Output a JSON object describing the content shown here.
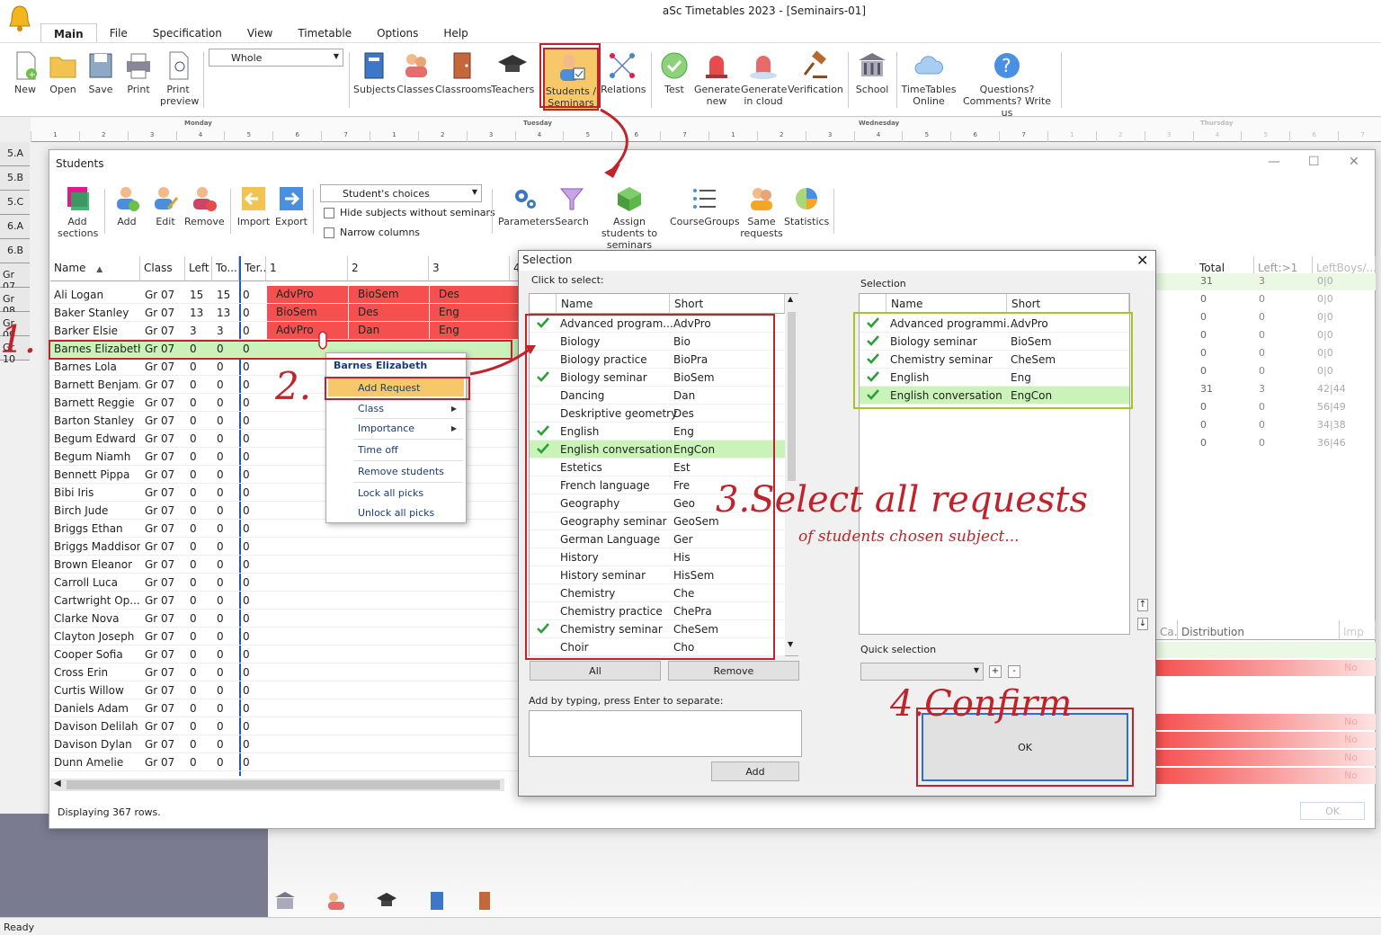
{
  "app": {
    "title": "aSc Timetables 2023  - [Seminairs-01]",
    "status": "Ready"
  },
  "ribbon": {
    "tabs": [
      "Main",
      "File",
      "Specification",
      "View",
      "Timetable",
      "Options",
      "Help"
    ],
    "view_select": "Whole",
    "buttons": {
      "new": "New",
      "open": "Open",
      "save": "Save",
      "print": "Print",
      "print_preview": "Print preview",
      "subjects": "Subjects",
      "classes": "Classes",
      "classrooms": "Classrooms",
      "teachers": "Teachers",
      "students_seminars": "Students / Seminars",
      "relations": "Relations",
      "test": "Test",
      "generate_new": "Generate new",
      "generate_cloud": "Generate in cloud",
      "verification": "Verification",
      "school": "School",
      "timetables_online": "TimeTables Online",
      "questions": "Questions? Comments? Write us"
    }
  },
  "timetable": {
    "days": [
      "Monday",
      "Tuesday",
      "Wednesday",
      "Thursday"
    ],
    "periods": [
      "1",
      "2",
      "3",
      "4",
      "5",
      "6",
      "7"
    ],
    "rows": [
      "5.A",
      "5.B",
      "5.C",
      "6.A",
      "6.B",
      "Gr 07",
      "Gr 08",
      "Gr 09",
      "Gr 10"
    ]
  },
  "students_window": {
    "title": "Students",
    "toolbar": {
      "add_sections": "Add sections",
      "add": "Add",
      "edit": "Edit",
      "remove": "Remove",
      "import": "Import",
      "export": "Export",
      "view_mode": "Student's choices",
      "hide_subjects": "Hide subjects without seminars",
      "narrow_columns": "Narrow columns",
      "parameters": "Parameters",
      "search": "Search",
      "assign": "Assign students to seminars",
      "coursegroups": "CourseGroups",
      "same_requests": "Same requests",
      "statistics": "Statistics"
    },
    "columns": [
      "Name",
      "Class",
      "Left",
      "To...",
      "Ter...",
      "1",
      "2",
      "3",
      "4"
    ],
    "right_columns": [
      "Total",
      "Left:>1",
      "LeftBoys/..."
    ],
    "right_values": [
      [
        "31",
        "3",
        "0|0"
      ],
      [
        "0",
        "0",
        "0|0"
      ],
      [
        "0",
        "0",
        "0|0"
      ],
      [
        "0",
        "0",
        "0|0"
      ],
      [
        "0",
        "0",
        "0|0"
      ],
      [
        "0",
        "0",
        "0|0"
      ],
      [
        "31",
        "3",
        "42|44"
      ],
      [
        "0",
        "0",
        "56|49"
      ],
      [
        "0",
        "0",
        "34|38"
      ],
      [
        "0",
        "0",
        "36|46"
      ]
    ],
    "right_lower_columns": [
      "Ca...",
      "Distribution",
      "Imp"
    ],
    "right_lower_values": [
      "No",
      "No",
      "No",
      "No",
      "No"
    ],
    "rows": [
      {
        "name": "Ali  Logan",
        "class": "Gr 07",
        "left": "15",
        "to": "15",
        "ter": "0",
        "c1": "AdvPro",
        "c2": "BioSem",
        "c3": "Des"
      },
      {
        "name": "Baker  Stanley",
        "class": "Gr 07",
        "left": "13",
        "to": "13",
        "ter": "0",
        "c1": "BioSem",
        "c2": "Des",
        "c3": "Eng"
      },
      {
        "name": "Barker  Elsie",
        "class": "Gr 07",
        "left": "3",
        "to": "3",
        "ter": "0",
        "c1": "AdvPro",
        "c2": "Dan",
        "c3": "Eng"
      },
      {
        "name": "Barnes  Elizabeth",
        "class": "Gr 07",
        "left": "0",
        "to": "0",
        "ter": "0",
        "c1": "",
        "c2": "",
        "c3": ""
      },
      {
        "name": "Barnes  Lola",
        "class": "Gr 07",
        "left": "0",
        "to": "0",
        "ter": "0",
        "c1": "",
        "c2": "",
        "c3": ""
      },
      {
        "name": "Barnett  Benjam...",
        "class": "Gr 07",
        "left": "0",
        "to": "0",
        "ter": "0",
        "c1": "",
        "c2": "",
        "c3": ""
      },
      {
        "name": "Barnett  Reggie",
        "class": "Gr 07",
        "left": "0",
        "to": "0",
        "ter": "0",
        "c1": "",
        "c2": "",
        "c3": ""
      },
      {
        "name": "Barton  Stanley",
        "class": "Gr 07",
        "left": "0",
        "to": "0",
        "ter": "0",
        "c1": "",
        "c2": "",
        "c3": ""
      },
      {
        "name": "Begum  Edward",
        "class": "Gr 07",
        "left": "0",
        "to": "0",
        "ter": "0",
        "c1": "",
        "c2": "",
        "c3": ""
      },
      {
        "name": "Begum  Niamh",
        "class": "Gr 07",
        "left": "0",
        "to": "0",
        "ter": "0",
        "c1": "",
        "c2": "",
        "c3": ""
      },
      {
        "name": "Bennett  Pippa",
        "class": "Gr 07",
        "left": "0",
        "to": "0",
        "ter": "0",
        "c1": "",
        "c2": "",
        "c3": ""
      },
      {
        "name": "Bibi  Iris",
        "class": "Gr 07",
        "left": "0",
        "to": "0",
        "ter": "0",
        "c1": "",
        "c2": "",
        "c3": ""
      },
      {
        "name": "Birch  Jude",
        "class": "Gr 07",
        "left": "0",
        "to": "0",
        "ter": "0",
        "c1": "",
        "c2": "",
        "c3": ""
      },
      {
        "name": "Briggs  Ethan",
        "class": "Gr 07",
        "left": "0",
        "to": "0",
        "ter": "0",
        "c1": "",
        "c2": "",
        "c3": ""
      },
      {
        "name": "Briggs  Maddison",
        "class": "Gr 07",
        "left": "0",
        "to": "0",
        "ter": "0",
        "c1": "",
        "c2": "",
        "c3": ""
      },
      {
        "name": "Brown  Eleanor",
        "class": "Gr 07",
        "left": "0",
        "to": "0",
        "ter": "0",
        "c1": "",
        "c2": "",
        "c3": ""
      },
      {
        "name": "Carroll  Luca",
        "class": "Gr 07",
        "left": "0",
        "to": "0",
        "ter": "0",
        "c1": "",
        "c2": "",
        "c3": ""
      },
      {
        "name": "Cartwright  Op...",
        "class": "Gr 07",
        "left": "0",
        "to": "0",
        "ter": "0",
        "c1": "",
        "c2": "",
        "c3": ""
      },
      {
        "name": "Clarke  Nova",
        "class": "Gr 07",
        "left": "0",
        "to": "0",
        "ter": "0",
        "c1": "",
        "c2": "",
        "c3": ""
      },
      {
        "name": "Clayton  Joseph",
        "class": "Gr 07",
        "left": "0",
        "to": "0",
        "ter": "0",
        "c1": "",
        "c2": "",
        "c3": ""
      },
      {
        "name": "Cooper  Sofia",
        "class": "Gr 07",
        "left": "0",
        "to": "0",
        "ter": "0",
        "c1": "",
        "c2": "",
        "c3": ""
      },
      {
        "name": "Cross  Erin",
        "class": "Gr 07",
        "left": "0",
        "to": "0",
        "ter": "0",
        "c1": "",
        "c2": "",
        "c3": ""
      },
      {
        "name": "Curtis  Willow",
        "class": "Gr 07",
        "left": "0",
        "to": "0",
        "ter": "0",
        "c1": "",
        "c2": "",
        "c3": ""
      },
      {
        "name": "Daniels  Adam",
        "class": "Gr 07",
        "left": "0",
        "to": "0",
        "ter": "0",
        "c1": "",
        "c2": "",
        "c3": ""
      },
      {
        "name": "Davison  Delilah",
        "class": "Gr 07",
        "left": "0",
        "to": "0",
        "ter": "0",
        "c1": "",
        "c2": "",
        "c3": ""
      },
      {
        "name": "Davison  Dylan",
        "class": "Gr 07",
        "left": "0",
        "to": "0",
        "ter": "0",
        "c1": "",
        "c2": "",
        "c3": ""
      },
      {
        "name": "Dunn  Amelie",
        "class": "Gr 07",
        "left": "0",
        "to": "0",
        "ter": "0",
        "c1": "",
        "c2": "",
        "c3": ""
      }
    ],
    "footer": "Displaying 367 rows.",
    "ok_label": "OK"
  },
  "context_menu": {
    "header": "Barnes  Elizabeth",
    "items": [
      "Add Request",
      "Class",
      "Importance",
      "Time off",
      "Remove students",
      "Lock all picks",
      "Unlock all picks"
    ]
  },
  "selection_dialog": {
    "title": "Selection",
    "left_label": "Click to select:",
    "right_label": "Selection",
    "col_name": "Name",
    "col_short": "Short",
    "items": [
      {
        "name": "Advanced program...",
        "short": "AdvPro",
        "checked": true,
        "hl": false
      },
      {
        "name": "Biology",
        "short": "Bio",
        "checked": false,
        "hl": false
      },
      {
        "name": "Biology practice",
        "short": "BioPra",
        "checked": false,
        "hl": false
      },
      {
        "name": "Biology seminar",
        "short": "BioSem",
        "checked": true,
        "hl": false
      },
      {
        "name": "Dancing",
        "short": "Dan",
        "checked": false,
        "hl": false
      },
      {
        "name": "Deskriptive geometry",
        "short": "Des",
        "checked": false,
        "hl": false
      },
      {
        "name": "English",
        "short": "Eng",
        "checked": true,
        "hl": false
      },
      {
        "name": "English conversation",
        "short": "EngCon",
        "checked": true,
        "hl": true
      },
      {
        "name": "Estetics",
        "short": "Est",
        "checked": false,
        "hl": false
      },
      {
        "name": "French language",
        "short": "Fre",
        "checked": false,
        "hl": false
      },
      {
        "name": "Geography",
        "short": "Geo",
        "checked": false,
        "hl": false
      },
      {
        "name": "Geography seminar",
        "short": "GeoSem",
        "checked": false,
        "hl": false
      },
      {
        "name": "German Language",
        "short": "Ger",
        "checked": false,
        "hl": false
      },
      {
        "name": "History",
        "short": "His",
        "checked": false,
        "hl": false
      },
      {
        "name": "History seminar",
        "short": "HisSem",
        "checked": false,
        "hl": false
      },
      {
        "name": "Chemistry",
        "short": "Che",
        "checked": false,
        "hl": false
      },
      {
        "name": "Chemistry practice",
        "short": "ChePra",
        "checked": false,
        "hl": false
      },
      {
        "name": "Chemistry seminar",
        "short": "CheSem",
        "checked": true,
        "hl": false
      },
      {
        "name": "Choir",
        "short": "Cho",
        "checked": false,
        "hl": false
      }
    ],
    "selected": [
      {
        "name": "Advanced programmi...",
        "short": "AdvPro",
        "hl": false
      },
      {
        "name": "Biology seminar",
        "short": "BioSem",
        "hl": false
      },
      {
        "name": "Chemistry seminar",
        "short": "CheSem",
        "hl": false
      },
      {
        "name": "English",
        "short": "Eng",
        "hl": false
      },
      {
        "name": "English conversation",
        "short": "EngCon",
        "hl": true
      }
    ],
    "all_button": "All",
    "remove_button": "Remove",
    "add_by_typing_label": "Add by typing, press Enter to separate:",
    "add_button": "Add",
    "quick_selection_label": "Quick selection",
    "plus": "+",
    "minus": "-",
    "ok_button": "OK"
  },
  "annotations": {
    "step1": "1.",
    "step2": "2.",
    "step3": "3.Select all requests",
    "step3_sub": "of students chosen subject...",
    "step4": "4.Confirm"
  },
  "colors": {
    "red_cell": "#f5504f",
    "green_row": "#c9f3b8",
    "annotation": "#c0232b",
    "green_box": "#a7c520"
  }
}
